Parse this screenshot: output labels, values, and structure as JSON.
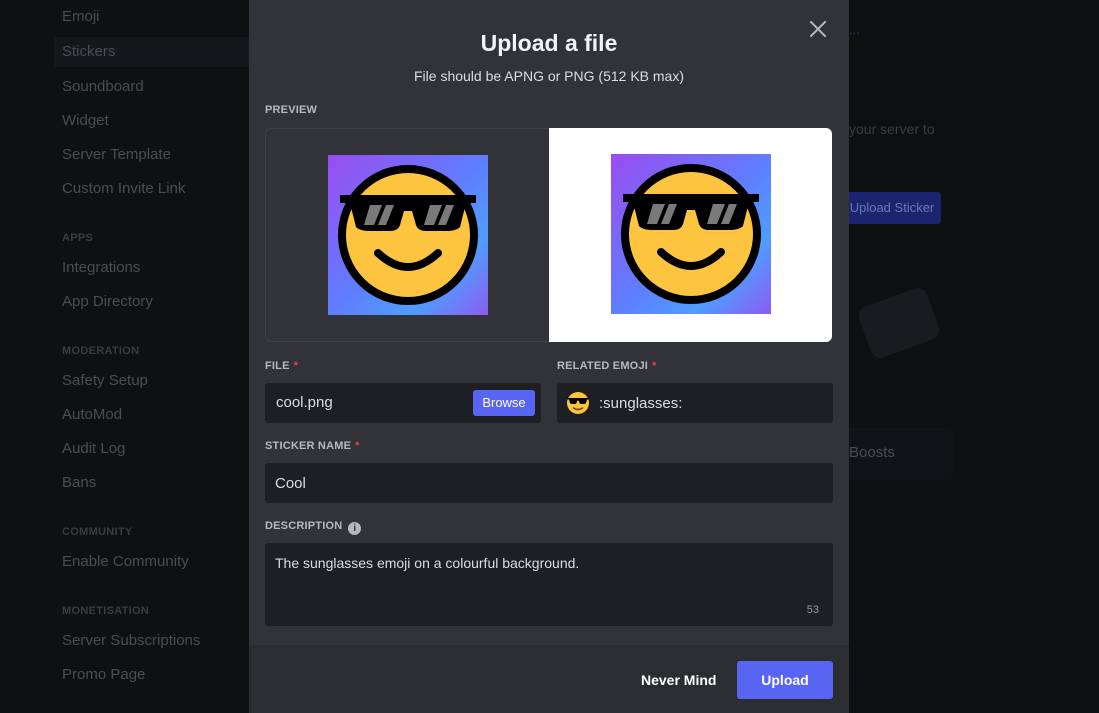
{
  "background": {
    "sidebar": {
      "items": [
        {
          "label": "Emoji"
        },
        {
          "label": "Stickers"
        },
        {
          "label": "Soundboard"
        },
        {
          "label": "Widget"
        },
        {
          "label": "Server Template"
        },
        {
          "label": "Custom Invite Link"
        },
        {
          "label": "Integrations"
        },
        {
          "label": "App Directory"
        },
        {
          "label": "Safety Setup"
        },
        {
          "label": "AutoMod"
        },
        {
          "label": "Audit Log"
        },
        {
          "label": "Bans"
        },
        {
          "label": "Enable Community"
        },
        {
          "label": "Server Subscriptions"
        },
        {
          "label": "Promo Page"
        }
      ],
      "sections": {
        "apps": "APPS",
        "moderation": "MODERATION",
        "community": "COMMUNITY",
        "monetisation": "MONETISATION"
      }
    },
    "right": {
      "link_fragment": "...",
      "text_fragment": "your server to",
      "upload_sticker": "Upload Sticker",
      "boosts": "Boosts"
    }
  },
  "modal": {
    "title": "Upload a file",
    "subtitle": "File should be APNG or PNG (512 KB max)",
    "preview_label": "PREVIEW",
    "file_label": "FILE",
    "file_value": "cool.png",
    "browse_label": "Browse",
    "related_emoji_label": "RELATED EMOJI",
    "related_emoji_value": ":sunglasses:",
    "sticker_name_label": "STICKER NAME",
    "sticker_name_value": "Cool",
    "description_label": "DESCRIPTION",
    "description_value": "The sunglasses emoji on a colourful background.",
    "description_count": "53",
    "required_mark": "*",
    "cancel_label": "Never Mind",
    "submit_label": "Upload"
  },
  "colors": {
    "accent": "#5865f2",
    "modal_bg": "#313338",
    "required": "#f23f43"
  },
  "icons": [
    "close-icon",
    "info-icon",
    "sunglasses-emoji-icon"
  ]
}
